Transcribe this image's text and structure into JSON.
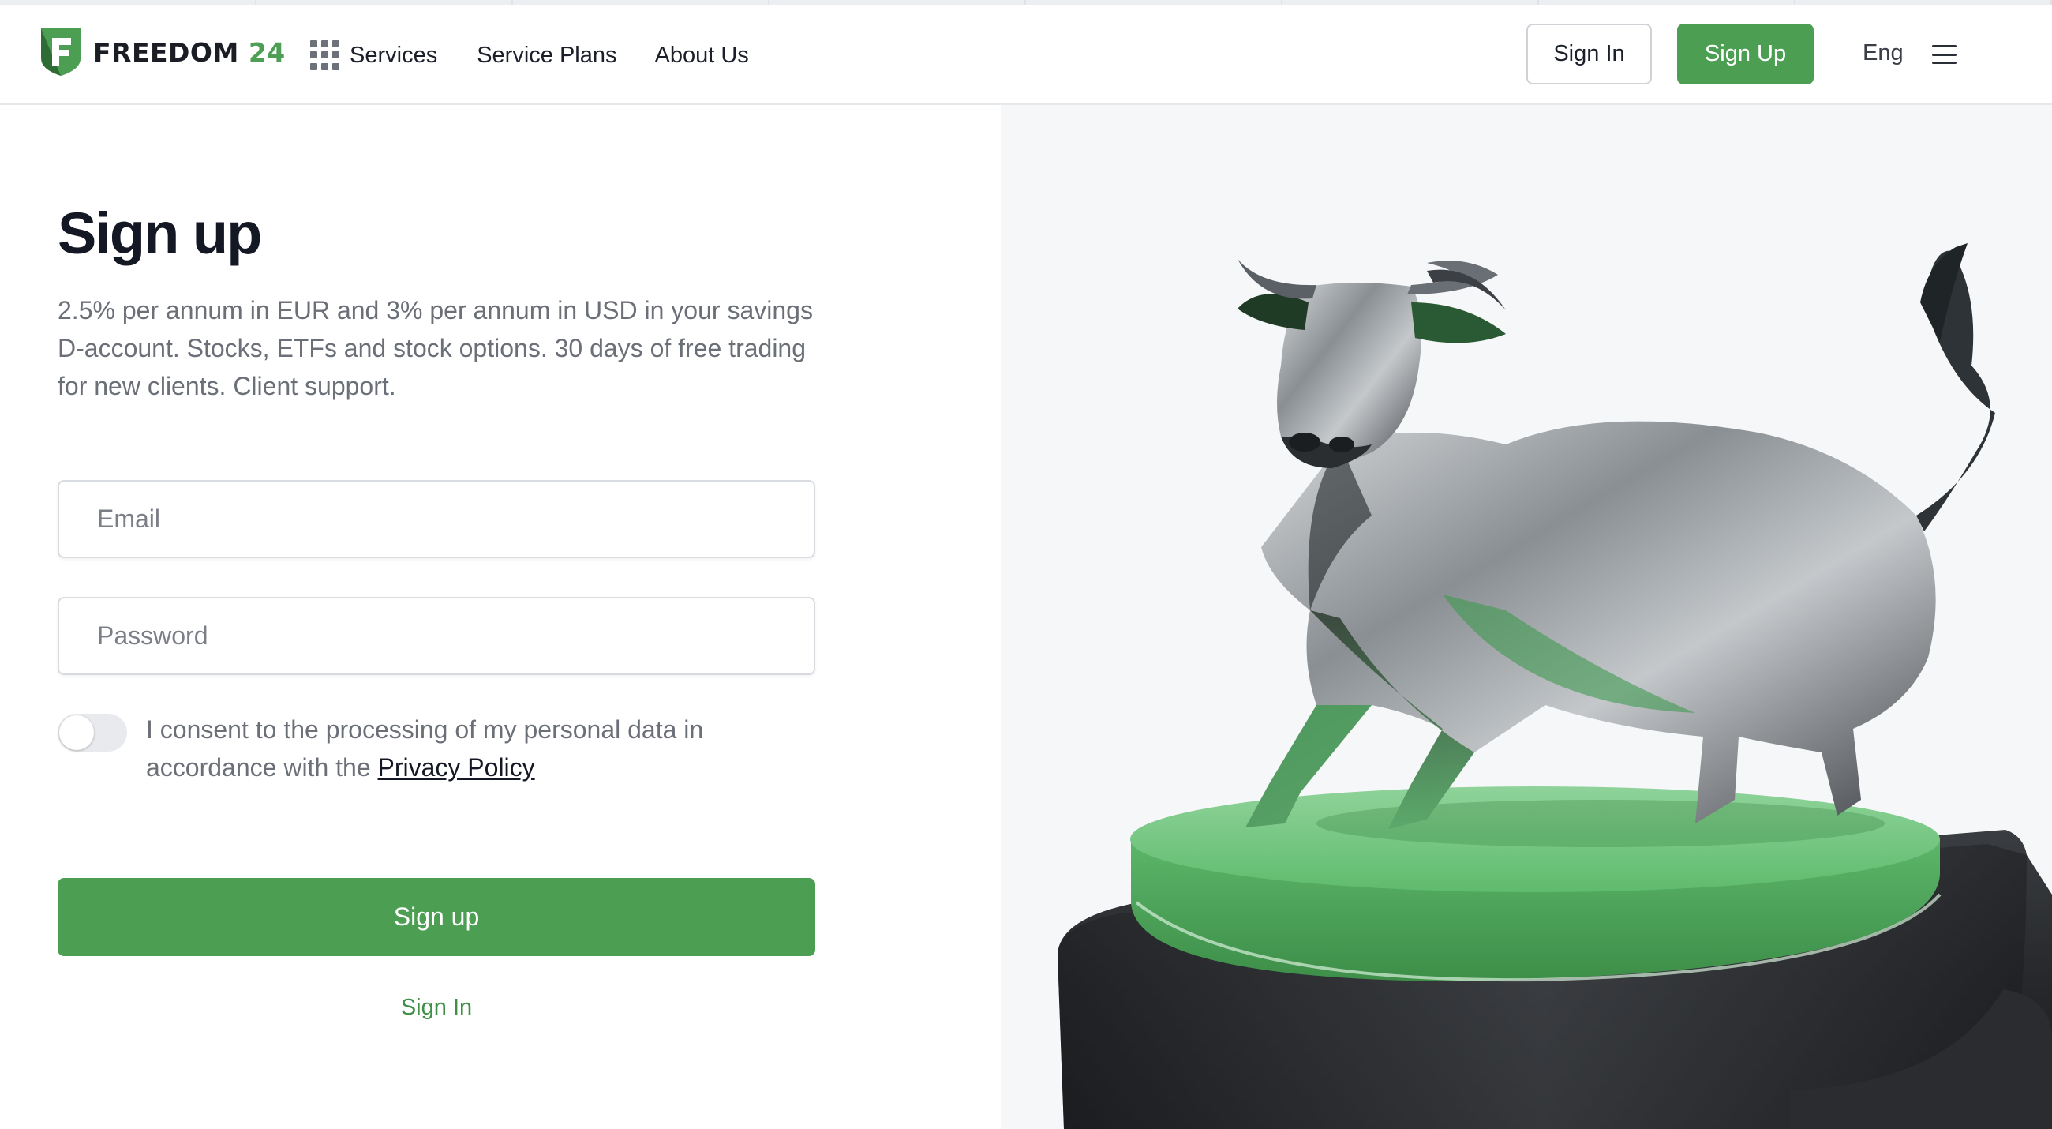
{
  "header": {
    "logo_word": "FREEDOM",
    "logo_number": "24",
    "nav": {
      "services": "Services",
      "service_plans": "Service Plans",
      "about_us": "About Us"
    },
    "sign_in": "Sign In",
    "sign_up": "Sign Up",
    "language": "Eng"
  },
  "form": {
    "title": "Sign up",
    "description": "2.5% per annum in EUR and 3% per annum in USD in your savings D-account. Stocks, ETFs and stock options. 30 days of free trading for new clients. Client support.",
    "email_placeholder": "Email",
    "password_placeholder": "Password",
    "consent_text": "I consent to the processing of my personal data in accordance with the",
    "privacy_link": "Privacy Policy",
    "consent_checked": false,
    "submit": "Sign up",
    "sign_in_link": "Sign In"
  },
  "colors": {
    "brand_green": "#4c9f52",
    "text_dark": "#141824",
    "text_muted": "#6b6f77"
  }
}
